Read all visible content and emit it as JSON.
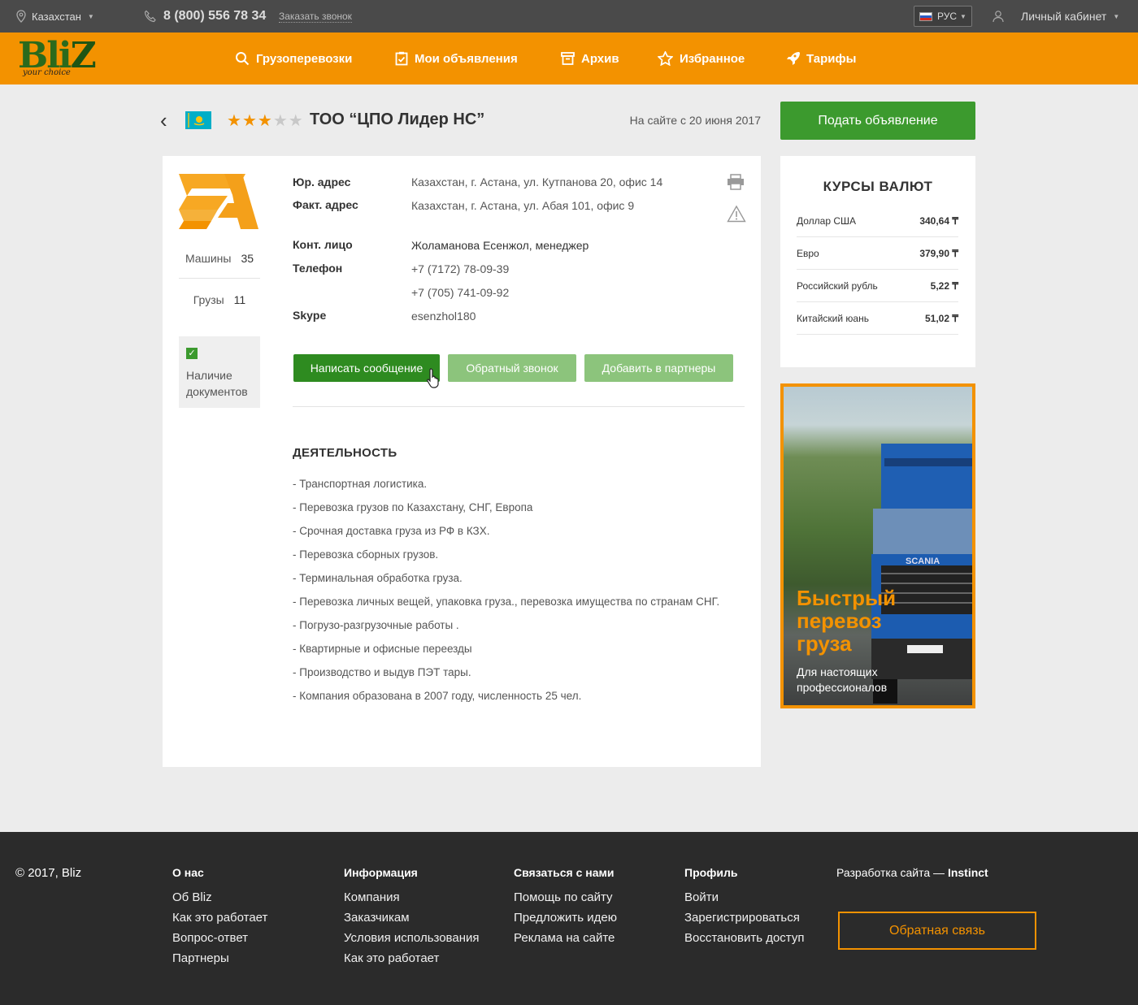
{
  "topbar": {
    "region": "Казахстан",
    "phone": "8 (800) 556 78 34",
    "callback_link": "Заказать звонок",
    "language": "РУС",
    "account": "Личный кабинет"
  },
  "logo": {
    "name": "Bliz",
    "tagline": "your choice"
  },
  "nav": [
    {
      "label": "Грузоперевозки",
      "icon": "search-icon"
    },
    {
      "label": "Мои объявления",
      "icon": "clipboard-icon"
    },
    {
      "label": "Архив",
      "icon": "archive-icon"
    },
    {
      "label": "Избранное",
      "icon": "star-icon"
    },
    {
      "label": "Тарифы",
      "icon": "rocket-icon"
    }
  ],
  "company": {
    "title": "ТОО “ЦПО Лидер НС”",
    "rating": 3,
    "rating_max": 5,
    "since": "На сайте с 20 июня 2017",
    "machines_label": "Машины",
    "machines_count": "35",
    "cargo_label": "Грузы",
    "cargo_count": "11",
    "docs_label": "Наличие документов",
    "details": [
      {
        "label": "Юр. адрес",
        "value": "Казахстан, г. Астана, ул. Кутпанова 20, офис 14"
      },
      {
        "label": "Факт.  адрес",
        "value": "Казахстан, г. Астана, ул. Абая 101, офис 9"
      },
      {
        "label": "Конт. лицо",
        "value": "Жоламанова Есенжол, менеджер"
      },
      {
        "label": "Телефон",
        "value": "+7 (7172) 78-09-39"
      },
      {
        "label": "",
        "value": "+7 (705) 741-09-92"
      },
      {
        "label": "Skype",
        "value": "esenzhol180"
      }
    ],
    "buttons": {
      "message": "Написать сообщение",
      "callback": "Обратный звонок",
      "partners": "Добавить в партнеры"
    },
    "activity_title": "ДЕЯТЕЛЬНОСТЬ",
    "activity": [
      "- Транспортная логистика.",
      "- Перевозка грузов по Казахстану, СНГ, Европа",
      "- Срочная доставка груза из РФ в КЗХ.",
      "- Перевозка сборных грузов.",
      "- Терминальная обработка груза.",
      "- Перевозка личных вещей, упаковка груза., перевозка имущества по странам СНГ.",
      "- Погрузо-разгрузочные работы .",
      "- Квартирные и офисные переезды",
      "- Производство и выдув ПЭТ тары.",
      "- Компания образована в 2007 году, численность 25 чел."
    ]
  },
  "post_ad_button": "Подать объявление",
  "currency": {
    "title": "КУРСЫ ВАЛЮТ",
    "rates": [
      {
        "name": "Доллар США",
        "value": "340,64 ₸"
      },
      {
        "name": "Евро",
        "value": "379,90 ₸"
      },
      {
        "name": "Российский рубль",
        "value": "5,22 ₸"
      },
      {
        "name": "Китайский юань",
        "value": "51,02 ₸"
      }
    ]
  },
  "banner": {
    "title_lines": [
      "Быстрый",
      "перевоз",
      "груза"
    ],
    "subtitle_lines": [
      "Для настоящих",
      "профессионалов"
    ],
    "truck_brand": "SCANIA"
  },
  "footer": {
    "copyright": "© 2017, Bliz",
    "columns": [
      {
        "heading": "О нас",
        "links": [
          "Об Bliz",
          "Как это работает",
          "Вопрос-ответ",
          "Партнеры"
        ]
      },
      {
        "heading": "Информация",
        "links": [
          "Компания",
          "Заказчикам",
          "Условия использования",
          "Как это работает"
        ]
      },
      {
        "heading": "Связаться с нами",
        "links": [
          "Помощь по сайту",
          "Предложить идею",
          "Реклама на сайте"
        ]
      },
      {
        "heading": "Профиль",
        "links": [
          "Войти",
          "Зарегистрироваться",
          "Восстановить доступ"
        ]
      }
    ],
    "developer_prefix": "Разработка сайта — ",
    "developer_name": "Instinct",
    "feedback_button": "Обратная связь"
  },
  "colors": {
    "accent": "#f39200",
    "primary_green": "#3c9a2e",
    "light_green": "#8cc47c",
    "footer_bg": "#2b2b2b",
    "topbar_bg": "#4a4a4a"
  }
}
